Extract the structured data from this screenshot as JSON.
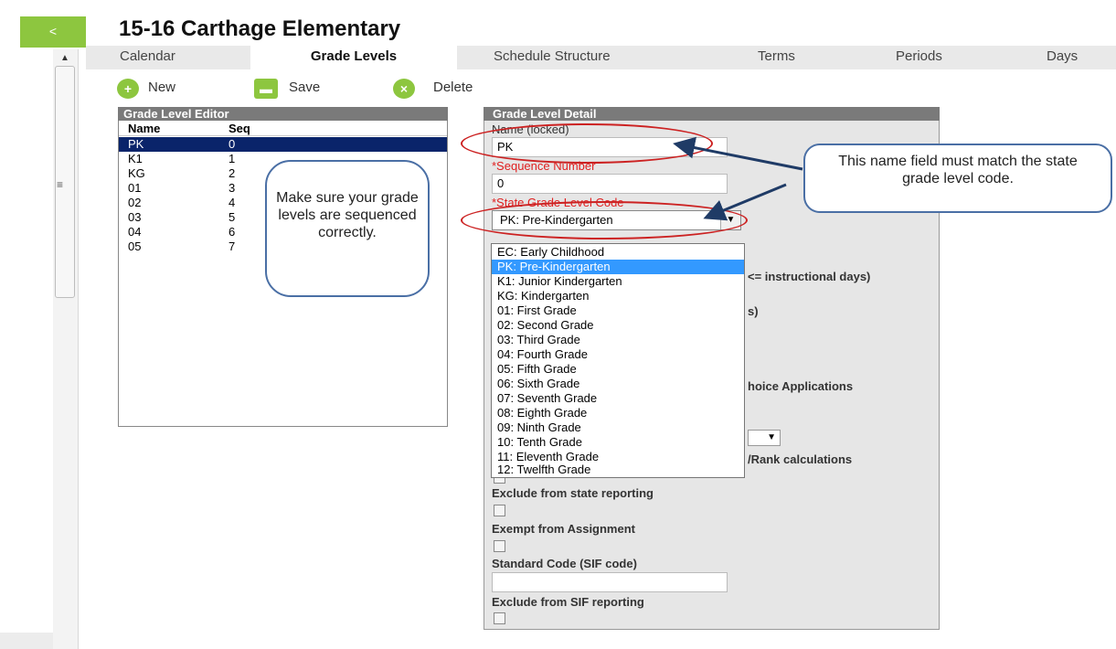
{
  "nav": {
    "back_label": "<",
    "scroll_up": "▲",
    "menu_icon": "≡"
  },
  "page": {
    "title": "15-16 Carthage Elementary"
  },
  "tabs": [
    {
      "label": "Calendar"
    },
    {
      "label": "Grade Levels"
    },
    {
      "label": "Schedule Structure"
    },
    {
      "label": "Terms"
    },
    {
      "label": "Periods"
    },
    {
      "label": "Days"
    }
  ],
  "toolbar": {
    "new_label": "New",
    "save_label": "Save",
    "delete_label": "Delete"
  },
  "editor": {
    "title": "Grade Level Editor",
    "col_name": "Name",
    "col_seq": "Seq",
    "rows": [
      {
        "name": "PK",
        "seq": "0"
      },
      {
        "name": "K1",
        "seq": "1"
      },
      {
        "name": "KG",
        "seq": "2"
      },
      {
        "name": "01",
        "seq": "3"
      },
      {
        "name": "02",
        "seq": "4"
      },
      {
        "name": "03",
        "seq": "5"
      },
      {
        "name": "04",
        "seq": "6"
      },
      {
        "name": "05",
        "seq": "7"
      }
    ]
  },
  "callouts": {
    "left": "Make sure your grade levels are sequenced correctly.",
    "right": "This name field must match the state grade level code."
  },
  "detail": {
    "title": "Grade Level Detail",
    "name_label": "Name (locked)",
    "name_value": "PK",
    "seq_label": "*Sequence Number",
    "seq_value": "0",
    "state_code_label": "*State Grade Level Code",
    "state_code_value": "PK: Pre-Kindergarten",
    "state_code_options": [
      "EC: Early Childhood",
      "PK: Pre-Kindergarten",
      "K1: Junior Kindergarten",
      "KG: Kindergarten",
      "01: First Grade",
      "02: Second Grade",
      "03: Third Grade",
      "04: Fourth Grade",
      "05: Fifth Grade",
      "06: Sixth Grade",
      "07: Seventh Grade",
      "08: Eighth Grade",
      "09: Ninth Grade",
      "10: Tenth Grade",
      "11: Eleventh Grade",
      "12: Twelfth Grade"
    ],
    "frag_instructional": "<= instructional days)",
    "frag_s": "s)",
    "frag_choice": "hoice Applications",
    "frag_rank": "/Rank calculations",
    "exclude_state_label": "Exclude from state reporting",
    "exempt_assignment_label": "Exempt from Assignment",
    "sif_code_label": "Standard Code (SIF code)",
    "sif_code_value": "",
    "exclude_sif_label": "Exclude from SIF reporting"
  },
  "colors": {
    "accent_green": "#8dc63f",
    "selection_navy": "#0a246a",
    "highlight_blue": "#3399ff",
    "annotation_red": "#cc2222",
    "callout_border": "#4a6fa5"
  }
}
